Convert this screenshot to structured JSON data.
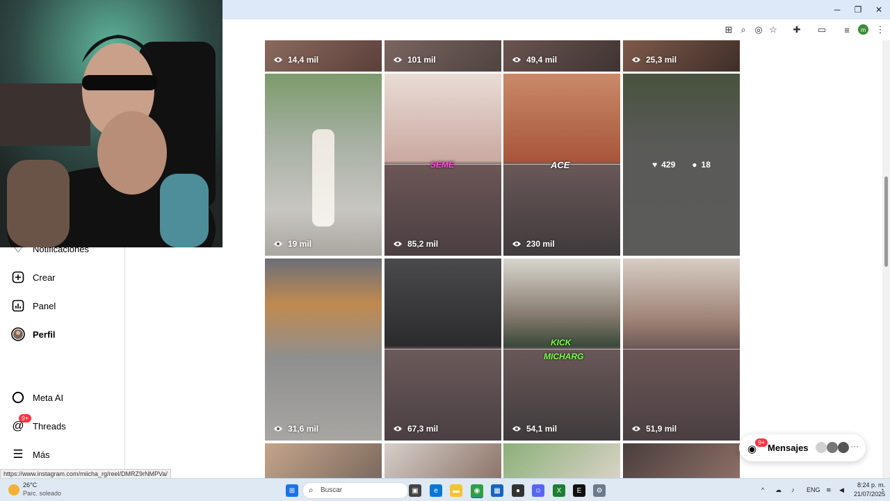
{
  "browser": {
    "status_url": "https://www.instagram.com/miicha_rg/reel/DMRZ9rNMPVa/",
    "profile_initial": "m",
    "controls": {
      "minimize": "─",
      "restore": "❐",
      "close": "✕"
    }
  },
  "sidebar": {
    "notifications": "Notificaciones",
    "create": "Crear",
    "panel": "Panel",
    "profile": "Perfil",
    "meta_ai": "Meta AI",
    "threads": "Threads",
    "threads_badge": "9+",
    "more": "Más"
  },
  "grid": {
    "row1": [
      "14,4 mil",
      "101 mil",
      "49,4 mil",
      "25,3 mil"
    ],
    "row2": [
      "19 mil",
      "85,2 mil",
      "230 mil"
    ],
    "row2_hover": {
      "likes": "429",
      "comments": "18"
    },
    "row2_labels": {
      "tile2": "SEME",
      "tile3": "ACE"
    },
    "row3": [
      "31,6 mil",
      "67,3 mil",
      "54,1 mil",
      "51,9 mil"
    ],
    "row3_labels": {
      "tile3a": "KICK",
      "tile3b": "MICHARG"
    }
  },
  "messages": {
    "label": "Mensajes",
    "badge": "9+"
  },
  "taskbar": {
    "weather_temp": "26°C",
    "weather_desc": "Parc. soleado",
    "search_placeholder": "Buscar",
    "lang": "ENG",
    "time": "8:24 p. m.",
    "date": "21/07/2025"
  },
  "colors": {
    "accent": "#3c8b36",
    "badge": "#ff3040",
    "titlebar": "#dde8f8",
    "taskbar": "#dfe9f3"
  }
}
